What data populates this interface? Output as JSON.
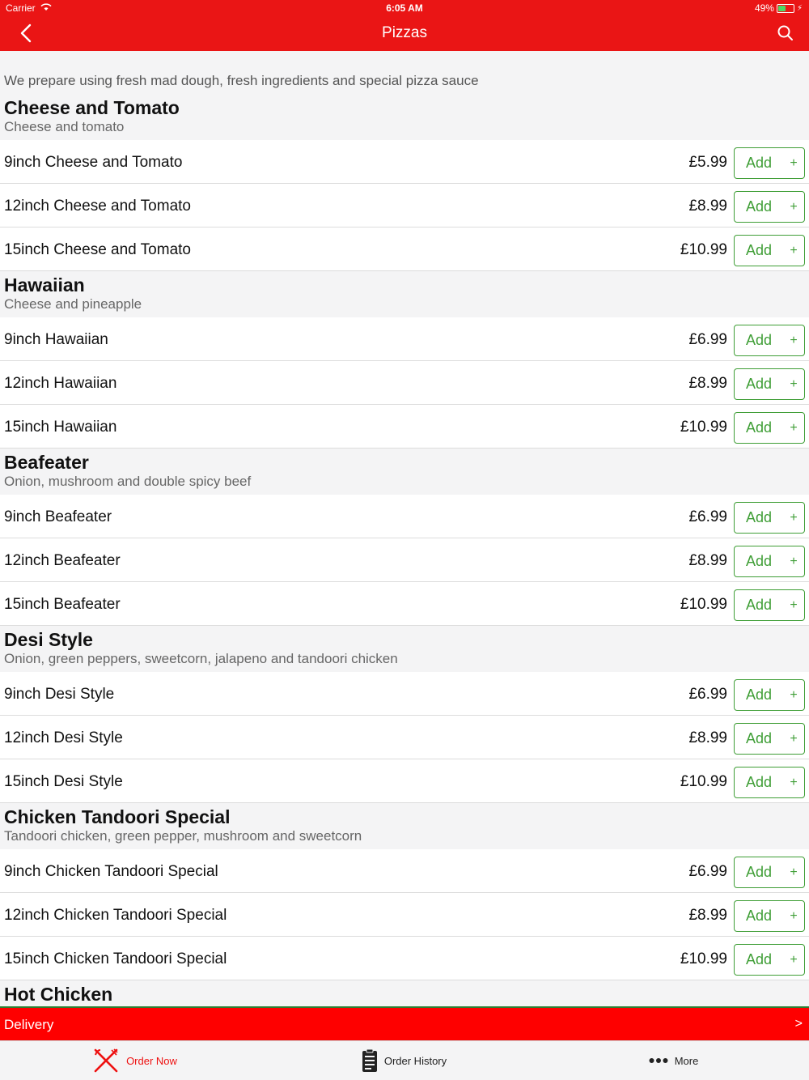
{
  "status_bar": {
    "carrier": "Carrier",
    "time": "6:05 AM",
    "battery": "49%",
    "battery_level": 0.49
  },
  "nav": {
    "title": "Pizzas"
  },
  "intro": "We prepare using fresh mad dough, fresh ingredients and special pizza sauce",
  "add_label": "Add",
  "add_plus": "+",
  "categories": [
    {
      "title": "Cheese and Tomato",
      "description": "Cheese and tomato",
      "items": [
        {
          "name": "9inch Cheese and Tomato",
          "price": "£5.99"
        },
        {
          "name": "12inch Cheese and Tomato",
          "price": "£8.99"
        },
        {
          "name": "15inch Cheese and Tomato",
          "price": "£10.99"
        }
      ]
    },
    {
      "title": "Hawaiian",
      "description": "Cheese and pineapple",
      "items": [
        {
          "name": "9inch Hawaiian",
          "price": "£6.99"
        },
        {
          "name": "12inch Hawaiian",
          "price": "£8.99"
        },
        {
          "name": "15inch Hawaiian",
          "price": "£10.99"
        }
      ]
    },
    {
      "title": "Beafeater",
      "description": "Onion, mushroom and double spicy beef",
      "items": [
        {
          "name": "9inch Beafeater",
          "price": "£6.99"
        },
        {
          "name": "12inch Beafeater",
          "price": "£8.99"
        },
        {
          "name": "15inch Beafeater",
          "price": "£10.99"
        }
      ]
    },
    {
      "title": "Desi Style",
      "description": "Onion, green peppers, sweetcorn, jalapeno and tandoori chicken",
      "items": [
        {
          "name": "9inch Desi Style",
          "price": "£6.99"
        },
        {
          "name": "12inch Desi Style",
          "price": "£8.99"
        },
        {
          "name": "15inch Desi Style",
          "price": "£10.99"
        }
      ]
    },
    {
      "title": "Chicken Tandoori Special",
      "description": "Tandoori chicken, green pepper, mushroom and sweetcorn",
      "items": [
        {
          "name": "9inch Chicken Tandoori Special",
          "price": "£6.99"
        },
        {
          "name": "12inch Chicken Tandoori Special",
          "price": "£8.99"
        },
        {
          "name": "15inch Chicken Tandoori Special",
          "price": "£10.99"
        }
      ]
    },
    {
      "title": "Hot Chicken",
      "description": "",
      "items": []
    }
  ],
  "delivery": {
    "label": "Delivery",
    "arrow": ">"
  },
  "tabs": [
    {
      "label": "Order Now",
      "icon": "fork-knife-icon",
      "active": true
    },
    {
      "label": "Order History",
      "icon": "clipboard-icon",
      "active": false
    },
    {
      "label": "More",
      "icon": "more-dots-icon",
      "active": false
    }
  ],
  "colors": {
    "brand_red": "#ea1515",
    "delivery_red": "#fe0000",
    "add_green": "#3f9e36"
  }
}
